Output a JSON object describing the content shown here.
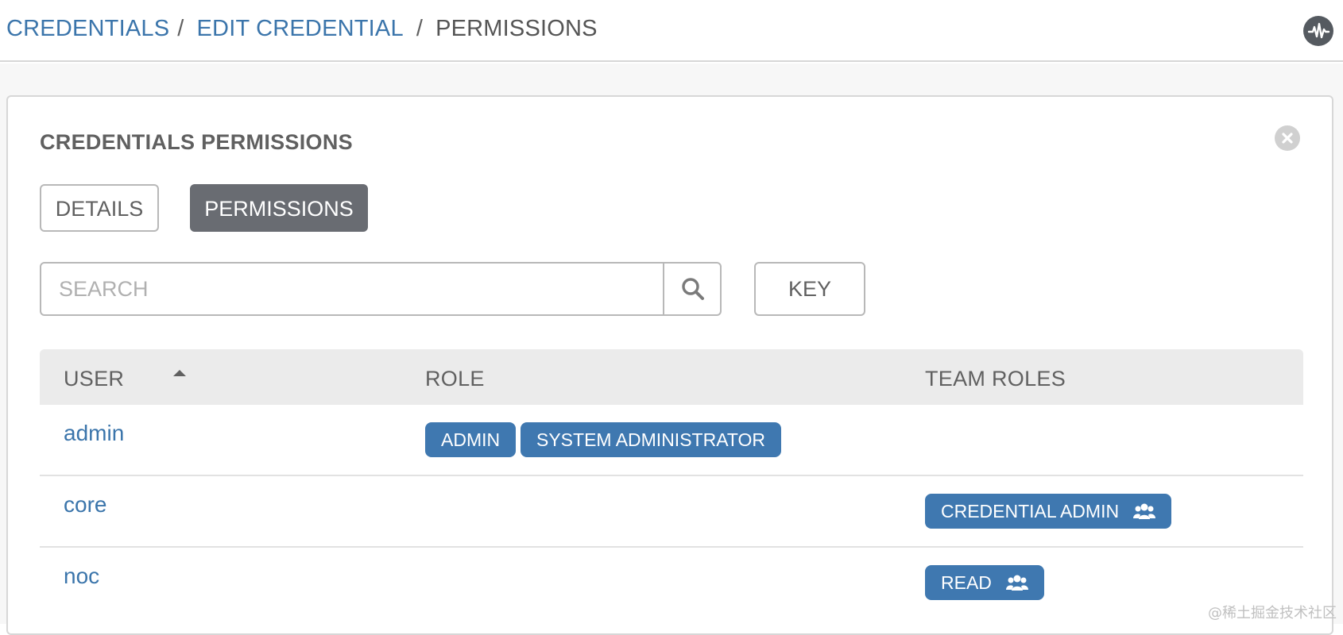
{
  "breadcrumb": {
    "items": [
      "CREDENTIALS",
      "EDIT CREDENTIAL"
    ],
    "separator": "/",
    "current": "PERMISSIONS"
  },
  "header": {
    "activity_icon": "activity-stream-icon"
  },
  "panel": {
    "title": "CREDENTIALS PERMISSIONS",
    "close_icon": "close-icon",
    "tabs": [
      {
        "label": "DETAILS",
        "active": false
      },
      {
        "label": "PERMISSIONS",
        "active": true
      }
    ],
    "search": {
      "placeholder": "SEARCH",
      "value": "",
      "icon": "search-icon"
    },
    "key_label": "KEY"
  },
  "table": {
    "columns": {
      "user": "USER",
      "role": "ROLE",
      "team_roles": "TEAM ROLES"
    },
    "sort": {
      "column": "user",
      "direction": "ascending"
    },
    "rows": [
      {
        "user": "admin",
        "roles": [
          "ADMIN",
          "SYSTEM ADMINISTRATOR"
        ],
        "team_roles": []
      },
      {
        "user": "core",
        "roles": [],
        "team_roles": [
          "CREDENTIAL ADMIN"
        ]
      },
      {
        "user": "noc",
        "roles": [],
        "team_roles": [
          "READ"
        ]
      }
    ]
  },
  "watermark": "@稀土掘金技术社区",
  "colors": {
    "link": "#3b75ab",
    "badge": "#3f78b0",
    "active_tab": "#696c72"
  }
}
